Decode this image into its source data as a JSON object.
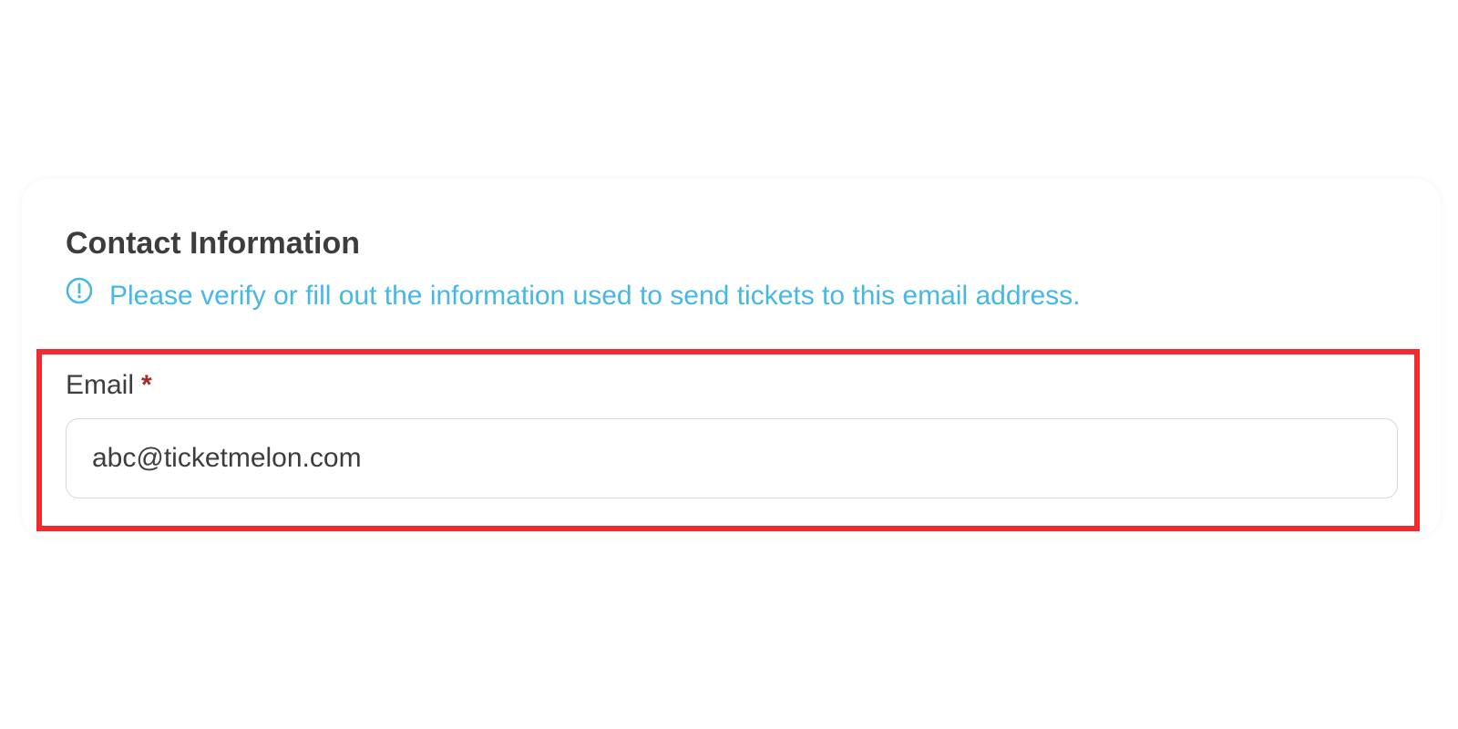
{
  "section": {
    "title": "Contact Information",
    "info_text": "Please verify or fill out the information used to send tickets to this email address.",
    "info_icon": "alert-circle-icon"
  },
  "email": {
    "label": "Email",
    "required_mark": "*",
    "value": "abc@ticketmelon.com"
  },
  "colors": {
    "info": "#46b8e3",
    "highlight": "#f2292d",
    "required": "#a52a2a",
    "text": "#3d3d3d"
  }
}
